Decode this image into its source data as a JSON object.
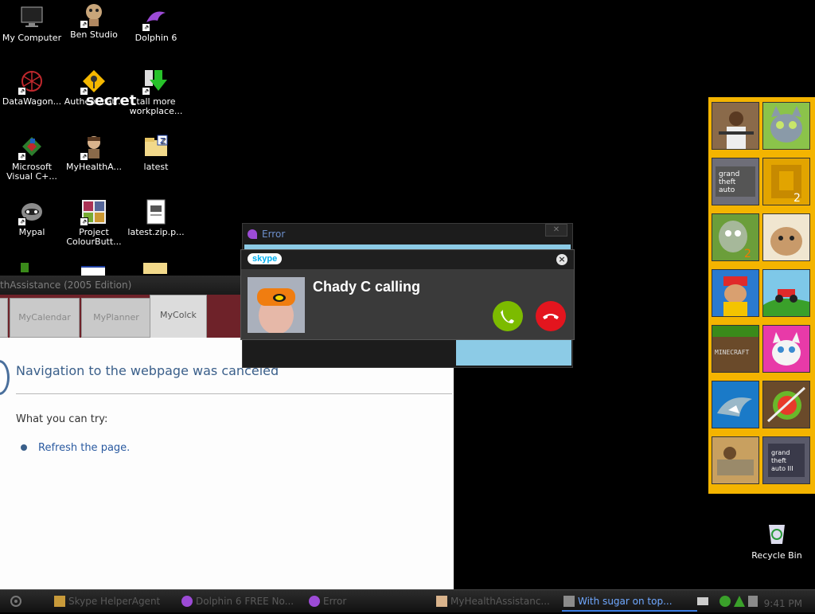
{
  "desktop": {
    "icons": [
      {
        "label": "My Computer"
      },
      {
        "label": "Ben Studio"
      },
      {
        "label": "Dolphin 6"
      },
      {
        "label": "DataWagon..."
      },
      {
        "label": "Authenticat..."
      },
      {
        "label": "tall more workplace..."
      },
      {
        "label": "Microsoft Visual C+..."
      },
      {
        "label": "MyHealthA..."
      },
      {
        "label": "latest"
      },
      {
        "label": "Mypal"
      },
      {
        "label": "Project ColourButt..."
      },
      {
        "label": "latest.zip.p..."
      }
    ],
    "overlay_text": "secret",
    "recycle_bin": "Recycle Bin"
  },
  "app_window": {
    "title": "thAssistance (2005 Edition)",
    "tabs": [
      {
        "label": "MyCalendar"
      },
      {
        "label": "MyPlanner"
      },
      {
        "label": "MyColck"
      }
    ],
    "nav_title": "Navigation to the webpage was canceled",
    "try_label": "What you can try:",
    "refresh_link": "Refresh the page."
  },
  "error_window": {
    "title": "Error",
    "close": "✕"
  },
  "skype": {
    "logo": "skype",
    "caller": "Chady C calling",
    "accept_color": "#7cbb00",
    "decline_color": "#e3151e"
  },
  "game_panel": {
    "background": "#f4b400"
  },
  "taskbar": {
    "items": [
      {
        "label": "Skype HelperAgent"
      },
      {
        "label": "Dolphin 6 FREE No..."
      },
      {
        "label": "Error"
      },
      {
        "label": "MyHealthAssistanc..."
      },
      {
        "label": "With sugar on top..."
      }
    ],
    "clock": "9:41 PM"
  }
}
